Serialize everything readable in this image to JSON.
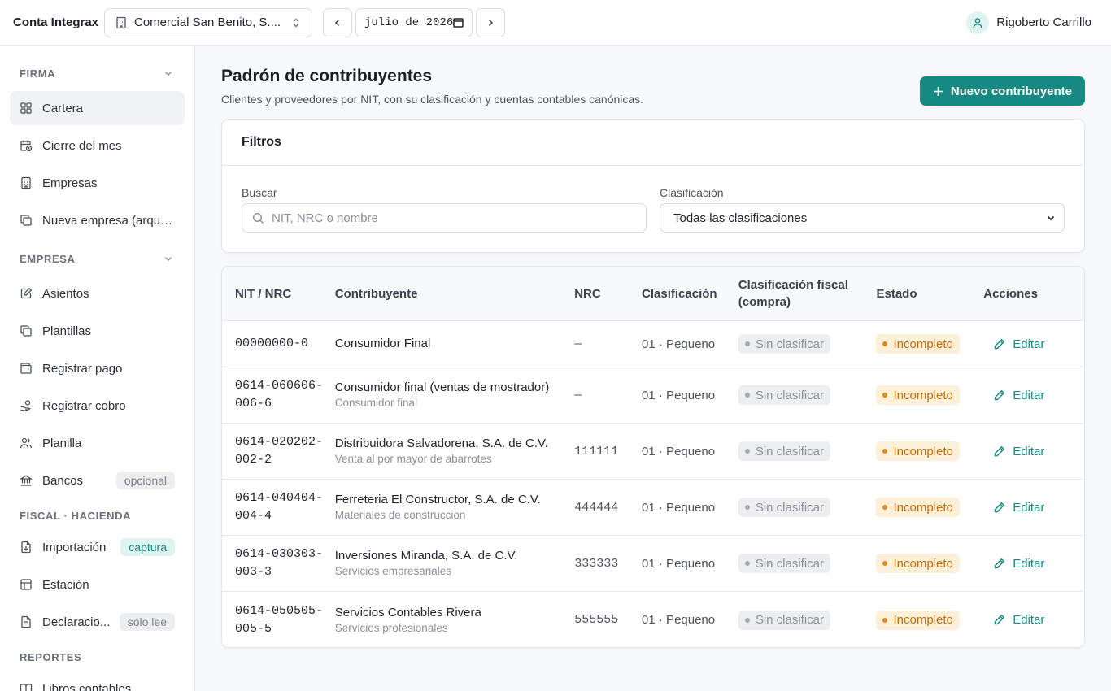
{
  "topbar": {
    "brand": "Conta Integrax",
    "company": "Comercial San Benito, S....",
    "month": "julio de 2026"
  },
  "user": {
    "name": "Rigoberto Carrillo"
  },
  "sidebar": {
    "firma_title": "FIRMA",
    "firma_items": [
      {
        "label": "Cartera"
      },
      {
        "label": "Cierre del mes"
      },
      {
        "label": "Empresas"
      },
      {
        "label": "Nueva empresa (arque..."
      }
    ],
    "empresa_title": "EMPRESA",
    "empresa_items": [
      {
        "label": "Asientos"
      },
      {
        "label": "Plantillas"
      },
      {
        "label": "Registrar pago"
      },
      {
        "label": "Registrar cobro"
      },
      {
        "label": "Planilla"
      },
      {
        "label": "Bancos",
        "tag": "opcional"
      }
    ],
    "fiscal_title": "FISCAL · HACIENDA",
    "fiscal_items": [
      {
        "label": "Importación",
        "tag": "captura"
      },
      {
        "label": "Estación"
      },
      {
        "label": "Declaracio...",
        "tag": "solo lee"
      }
    ],
    "reportes_title": "REPORTES",
    "reportes_items": [
      {
        "label": "Libros contables"
      }
    ]
  },
  "page": {
    "title": "Padrón de contribuyentes",
    "subtitle": "Clientes y proveedores por NIT, con su clasificación y cuentas contables canónicas.",
    "new_button": "Nuevo contribuyente"
  },
  "filters": {
    "title": "Filtros",
    "search_label": "Buscar",
    "search_placeholder": "NIT, NRC o nombre",
    "class_label": "Clasificación",
    "class_value": "Todas las clasificaciones"
  },
  "table": {
    "headers": {
      "nit": "NIT / NRC",
      "name": "Contribuyente",
      "nrc": "NRC",
      "class": "Clasificación",
      "fiscal": "Clasificación fiscal (compra)",
      "status": "Estado",
      "actions": "Acciones"
    },
    "rows": [
      {
        "nit": "00000000-0",
        "name": "Consumidor Final",
        "sub": "",
        "nrc": "—",
        "class": "01 · Pequeno",
        "fiscal": "Sin clasificar",
        "status": "Incompleto",
        "action": "Editar"
      },
      {
        "nit": "0614-060606-006-6",
        "name": "Consumidor final (ventas de mostrador)",
        "sub": "Consumidor final",
        "nrc": "—",
        "class": "01 · Pequeno",
        "fiscal": "Sin clasificar",
        "status": "Incompleto",
        "action": "Editar"
      },
      {
        "nit": "0614-020202-002-2",
        "name": "Distribuidora Salvadorena, S.A. de C.V.",
        "sub": "Venta al por mayor de abarrotes",
        "nrc": "111111",
        "class": "01 · Pequeno",
        "fiscal": "Sin clasificar",
        "status": "Incompleto",
        "action": "Editar"
      },
      {
        "nit": "0614-040404-004-4",
        "name": "Ferreteria El Constructor, S.A. de C.V.",
        "sub": "Materiales de construccion",
        "nrc": "444444",
        "class": "01 · Pequeno",
        "fiscal": "Sin clasificar",
        "status": "Incompleto",
        "action": "Editar"
      },
      {
        "nit": "0614-030303-003-3",
        "name": "Inversiones Miranda, S.A. de C.V.",
        "sub": "Servicios empresariales",
        "nrc": "333333",
        "class": "01 · Pequeno",
        "fiscal": "Sin clasificar",
        "status": "Incompleto",
        "action": "Editar"
      },
      {
        "nit": "0614-050505-005-5",
        "name": "Servicios Contables Rivera",
        "sub": "Servicios profesionales",
        "nrc": "555555",
        "class": "01 · Pequeno",
        "fiscal": "Sin clasificar",
        "status": "Incompleto",
        "action": "Editar"
      }
    ]
  },
  "colors": {
    "accent": "#168a82",
    "warning_bg": "#fdf0d9",
    "warning_text": "#c26d0b"
  }
}
